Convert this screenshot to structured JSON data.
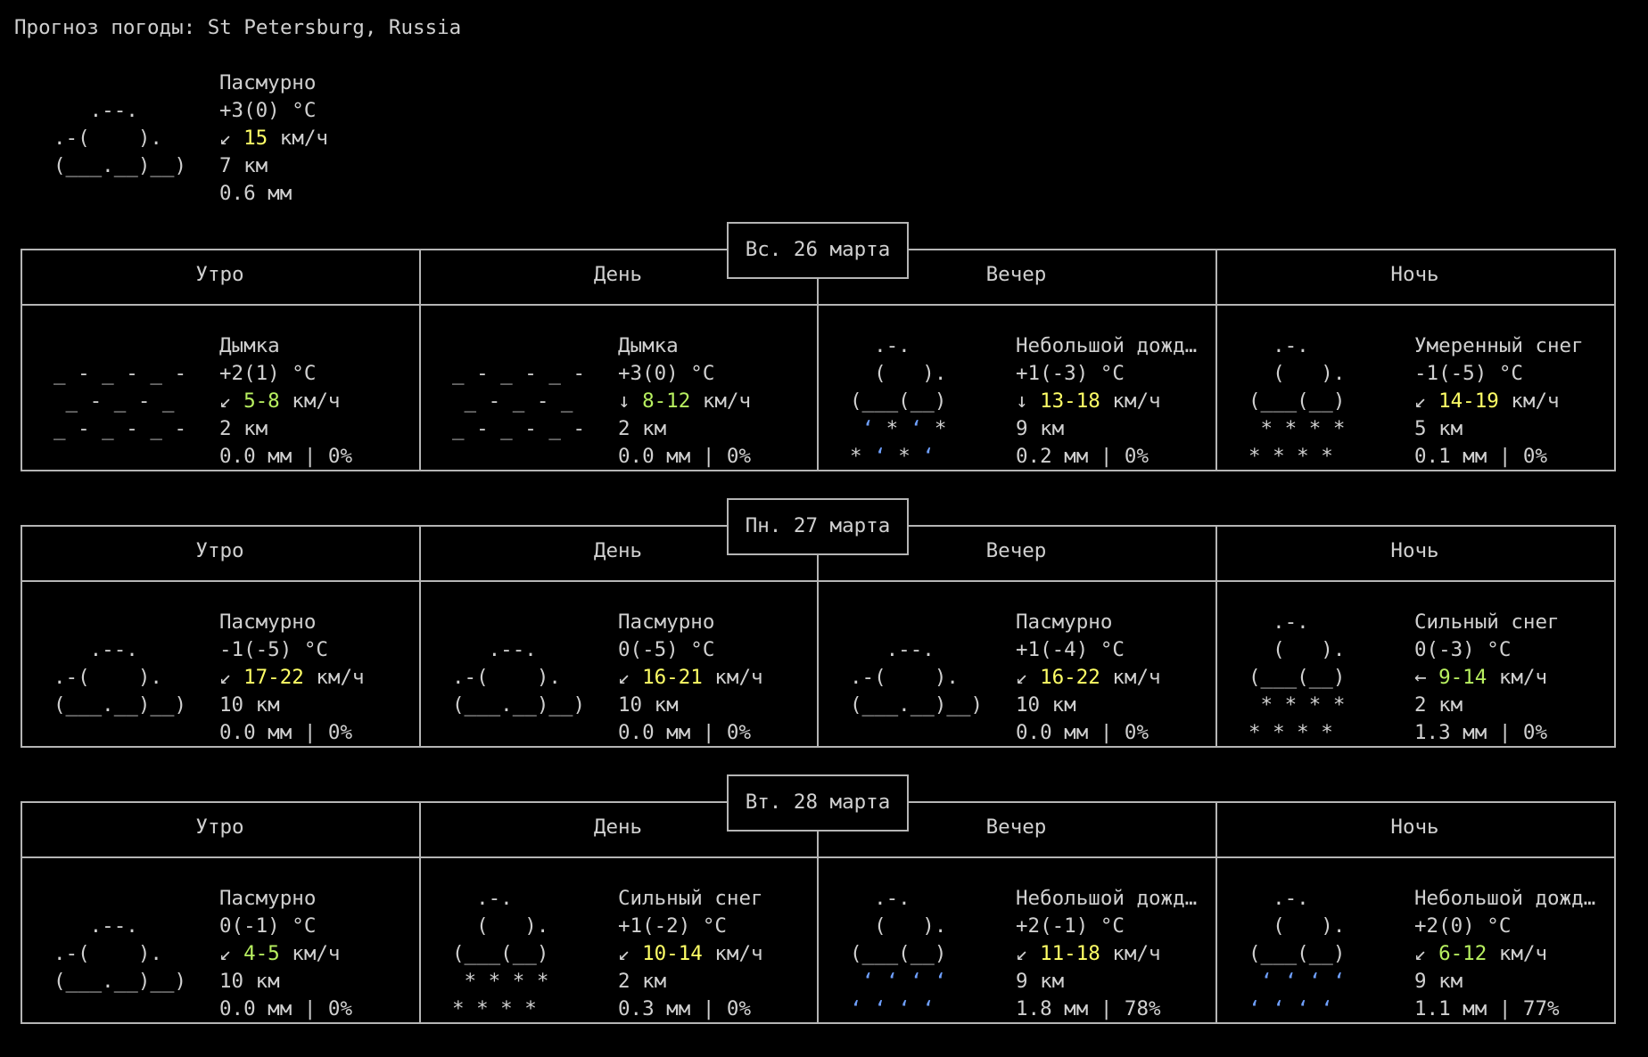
{
  "title": "Прогноз погоды: St Petersburg, Russia",
  "current": {
    "art": [
      "",
      "   .--.",
      ".-(    ).",
      "(___.__)__)",
      ""
    ],
    "condition": "Пасмурно",
    "temp": "+3(0) °C",
    "wind_dir": "↙",
    "wind": "15",
    "wind_unit": "км/ч",
    "visibility": "7 км",
    "precip": "0.6 мм"
  },
  "periods": [
    "Утро",
    "День",
    "Вечер",
    "Ночь"
  ],
  "days": [
    {
      "date": "Вс. 26 марта",
      "slots": [
        {
          "art": [
            "",
            "_ - _ - _ -",
            " _ - _ - _",
            "_ - _ - _ -",
            ""
          ],
          "condition": "Дымка",
          "temp": "+2(1) °C",
          "wind_dir": "↙",
          "wind": "5-8",
          "wind_unit": "км/ч",
          "visibility": "2 км",
          "precip": "0.0 мм | 0%"
        },
        {
          "art": [
            "",
            "_ - _ - _ -",
            " _ - _ - _",
            "_ - _ - _ -",
            ""
          ],
          "condition": "Дымка",
          "temp": "+3(0) °C",
          "wind_dir": "↓",
          "wind": "8-12",
          "wind_unit": "км/ч",
          "visibility": "2 км",
          "precip": "0.0 мм | 0%"
        },
        {
          "art": [
            "  .-.",
            "  (   ).",
            "(___(__)",
            " ʻ * ʻ *",
            "* ʻ * ʻ"
          ],
          "condition": "Небольшой дожд…",
          "temp": "+1(-3) °C",
          "wind_dir": "↓",
          "wind": "13-18",
          "wind_unit": "км/ч",
          "visibility": "9 км",
          "precip": "0.2 мм | 0%"
        },
        {
          "art": [
            "  .-.",
            "  (   ).",
            "(___(__)",
            " * * * *",
            "* * * *"
          ],
          "condition": "Умеренный снег",
          "temp": "-1(-5) °C",
          "wind_dir": "↙",
          "wind": "14-19",
          "wind_unit": "км/ч",
          "visibility": "5 км",
          "precip": "0.1 мм | 0%"
        }
      ]
    },
    {
      "date": "Пн. 27 марта",
      "slots": [
        {
          "art": [
            "",
            "   .--.",
            ".-(    ).",
            "(___.__)__)",
            ""
          ],
          "condition": "Пасмурно",
          "temp": "-1(-5) °C",
          "wind_dir": "↙",
          "wind": "17-22",
          "wind_unit": "км/ч",
          "visibility": "10 км",
          "precip": "0.0 мм | 0%"
        },
        {
          "art": [
            "",
            "   .--.",
            ".-(    ).",
            "(___.__)__)",
            ""
          ],
          "condition": "Пасмурно",
          "temp": "0(-5) °C",
          "wind_dir": "↙",
          "wind": "16-21",
          "wind_unit": "км/ч",
          "visibility": "10 км",
          "precip": "0.0 мм | 0%"
        },
        {
          "art": [
            "",
            "   .--.",
            ".-(    ).",
            "(___.__)__)",
            ""
          ],
          "condition": "Пасмурно",
          "temp": "+1(-4) °C",
          "wind_dir": "↙",
          "wind": "16-22",
          "wind_unit": "км/ч",
          "visibility": "10 км",
          "precip": "0.0 мм | 0%"
        },
        {
          "art": [
            "  .-.",
            "  (   ).",
            "(___(__)",
            " * * * *",
            "* * * *"
          ],
          "condition": "Сильный снег",
          "temp": "0(-3) °C",
          "wind_dir": "←",
          "wind": "9-14",
          "wind_unit": "км/ч",
          "visibility": "2 км",
          "precip": "1.3 мм | 0%"
        }
      ]
    },
    {
      "date": "Вт. 28 марта",
      "slots": [
        {
          "art": [
            "",
            "   .--.",
            ".-(    ).",
            "(___.__)__)",
            ""
          ],
          "condition": "Пасмурно",
          "temp": "0(-1) °C",
          "wind_dir": "↙",
          "wind": "4-5",
          "wind_unit": "км/ч",
          "visibility": "10 км",
          "precip": "0.0 мм | 0%"
        },
        {
          "art": [
            "  .-.",
            "  (   ).",
            "(___(__)",
            " * * * *",
            "* * * *"
          ],
          "condition": "Сильный снег",
          "temp": "+1(-2) °C",
          "wind_dir": "↙",
          "wind": "10-14",
          "wind_unit": "км/ч",
          "visibility": "2 км",
          "precip": "0.3 мм | 0%"
        },
        {
          "art": [
            "  .-.",
            "  (   ).",
            "(___(__)",
            " ʻ ʻ ʻ ʻ",
            "ʻ ʻ ʻ ʻ"
          ],
          "condition": "Небольшой дожд…",
          "temp": "+2(-1) °C",
          "wind_dir": "↙",
          "wind": "11-18",
          "wind_unit": "км/ч",
          "visibility": "9 км",
          "precip": "1.8 мм | 78%"
        },
        {
          "art": [
            "  .-.",
            "  (   ).",
            "(___(__)",
            " ʻ ʻ ʻ ʻ",
            "ʻ ʻ ʻ ʻ"
          ],
          "condition": "Небольшой дожд…",
          "temp": "+2(0) °C",
          "wind_dir": "↙",
          "wind": "6-12",
          "wind_unit": "км/ч",
          "visibility": "9 км",
          "precip": "1.1 мм | 77%"
        }
      ]
    }
  ],
  "colors": {
    "background": "#000000",
    "text": "#d0d0d0",
    "border": "#b5b5b5",
    "wind_high": "#ffff66",
    "wind_low": "#b8f060",
    "rain": "#6fa0ff"
  }
}
